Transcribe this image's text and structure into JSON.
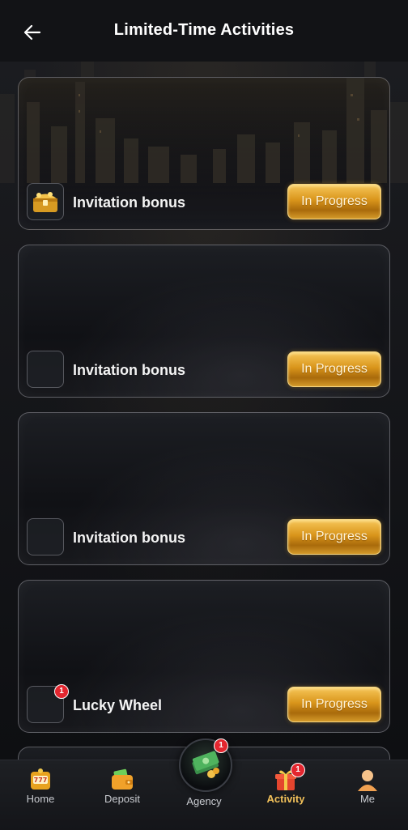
{
  "header": {
    "title": "Limited-Time Activities"
  },
  "cards": [
    {
      "title": "Invitation bonus",
      "button": "In Progress",
      "icon": "treasure-chest-icon"
    },
    {
      "title": "Invitation bonus",
      "button": "In Progress",
      "icon": ""
    },
    {
      "title": "Invitation bonus",
      "button": "In Progress",
      "icon": ""
    },
    {
      "title": "Lucky Wheel",
      "button": "In Progress",
      "icon": "",
      "badge": "1"
    }
  ],
  "tabbar": {
    "home": "Home",
    "deposit": "Deposit",
    "agency": "Agency",
    "agency_badge": "1",
    "activity": "Activity",
    "activity_badge": "1",
    "me": "Me",
    "active": "activity"
  },
  "colors": {
    "accent": "#f2c15a",
    "button_gold": "#d9951b",
    "badge": "#e3262f"
  }
}
